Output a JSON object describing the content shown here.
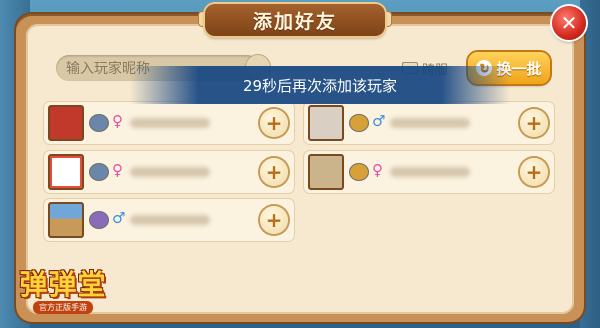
{
  "dialog": {
    "title": "添加好友",
    "close_icon": "close-icon"
  },
  "search": {
    "placeholder": "输入玩家昵称",
    "icon": "search-icon"
  },
  "cross_server": {
    "label": "跨服",
    "icon": "monitor-icon"
  },
  "refresh": {
    "label": "换一批",
    "icon": "refresh-icon"
  },
  "toast": {
    "message": "29秒后再次添加该玩家"
  },
  "players": [
    {
      "rank_color": "#6a86a8",
      "gender": "♀",
      "gender_color": "#e64fa8",
      "avatar_color": "#c0392b",
      "add_label": "+"
    },
    {
      "rank_color": "#d8a038",
      "gender": "♂",
      "gender_color": "#3c8fe0",
      "avatar_color": "#d9d0c3",
      "add_label": "+"
    },
    {
      "rank_color": "#6a86a8",
      "gender": "♀",
      "gender_color": "#e64fa8",
      "avatar_color": "#e74c3c",
      "add_label": "+"
    },
    {
      "rank_color": "#d8a038",
      "gender": "♀",
      "gender_color": "#e64fa8",
      "avatar_color": "#cbb48c",
      "add_label": "+"
    },
    {
      "rank_color": "#8a6bb8",
      "gender": "♂",
      "gender_color": "#3c8fe0",
      "avatar_color": "#c89a5a",
      "add_label": "+"
    }
  ],
  "logo": {
    "main": "弹弹堂",
    "sub": "官方正版手游"
  },
  "colors": {
    "panel": "#f6e9cf",
    "frame": "#c99156",
    "accent": "#f0a31a"
  }
}
